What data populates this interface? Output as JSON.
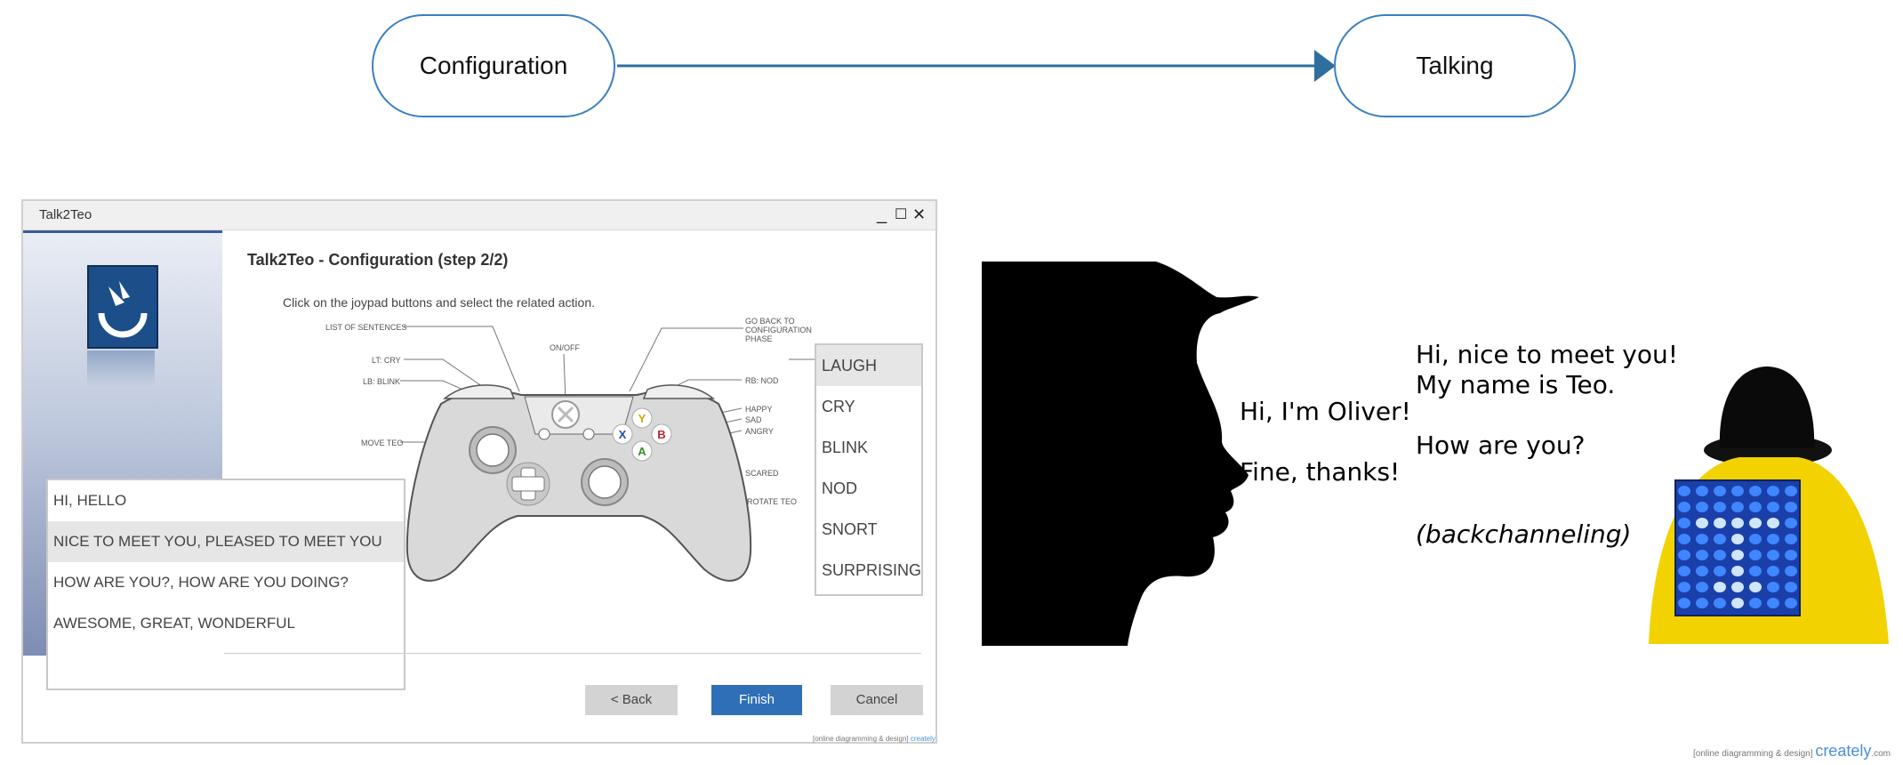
{
  "flow": {
    "start_label": "Configuration",
    "end_label": "Talking",
    "arrow_color": "#2e6f9e"
  },
  "window": {
    "title": "Talk2Teo",
    "controls": {
      "minimize": "_",
      "maximize": "☐",
      "close": "✕"
    },
    "heading": "Talk2Teo - Configuration (step 2/2)",
    "instruction": "Click on the joypad buttons and select the related action.",
    "controller_labels": {
      "list_of_sentences": "LIST OF SENTENCES",
      "lt_cry": "LT: CRY",
      "lb_blink": "LB: BLINK",
      "move_teo": "MOVE TEO",
      "on_off": "ON/OFF",
      "go_back": "GO BACK TO CONFIGURATION PHASE",
      "rb_nod": "RB: NOD",
      "happy": "HAPPY",
      "sad": "SAD",
      "angry": "ANGRY",
      "scared": "SCARED",
      "rotate_teo": "ROTATE TEO"
    },
    "face_buttons": {
      "y": "Y",
      "x": "X",
      "b": "B",
      "a": "A"
    },
    "actions": [
      "LAUGH",
      "CRY",
      "BLINK",
      "NOD",
      "SNORT",
      "SURPRISING"
    ],
    "selected_action": "LAUGH",
    "sentences": [
      "HI, HELLO",
      "NICE TO MEET YOU, PLEASED TO MEET YOU",
      "HOW ARE YOU?, HOW ARE YOU DOING?",
      "AWESOME, GREAT, WONDERFUL"
    ],
    "selected_sentence": "NICE TO MEET YOU, PLEASED TO MEET YOU",
    "buttons": {
      "back": "< Back",
      "finish": "Finish",
      "cancel": "Cancel"
    },
    "credit": {
      "prefix": "[online diagramming & design]",
      "brand": "creately"
    }
  },
  "conversation": {
    "oliver_lines": [
      "Hi, I'm Oliver!",
      "Fine, thanks!"
    ],
    "teo_lines": [
      "Hi, nice to meet you!",
      "My name is Teo.",
      "How are you?"
    ],
    "teo_note": "(backchanneling)"
  },
  "footer_credit": {
    "prefix": "[online diagramming & design]",
    "brand": "creately",
    "suffix": ".com"
  },
  "colors": {
    "accent": "#2f6fb7",
    "pill_border": "#3a7fc1",
    "teo_body": "#f2d200",
    "teo_leds": "#1e6bff"
  }
}
